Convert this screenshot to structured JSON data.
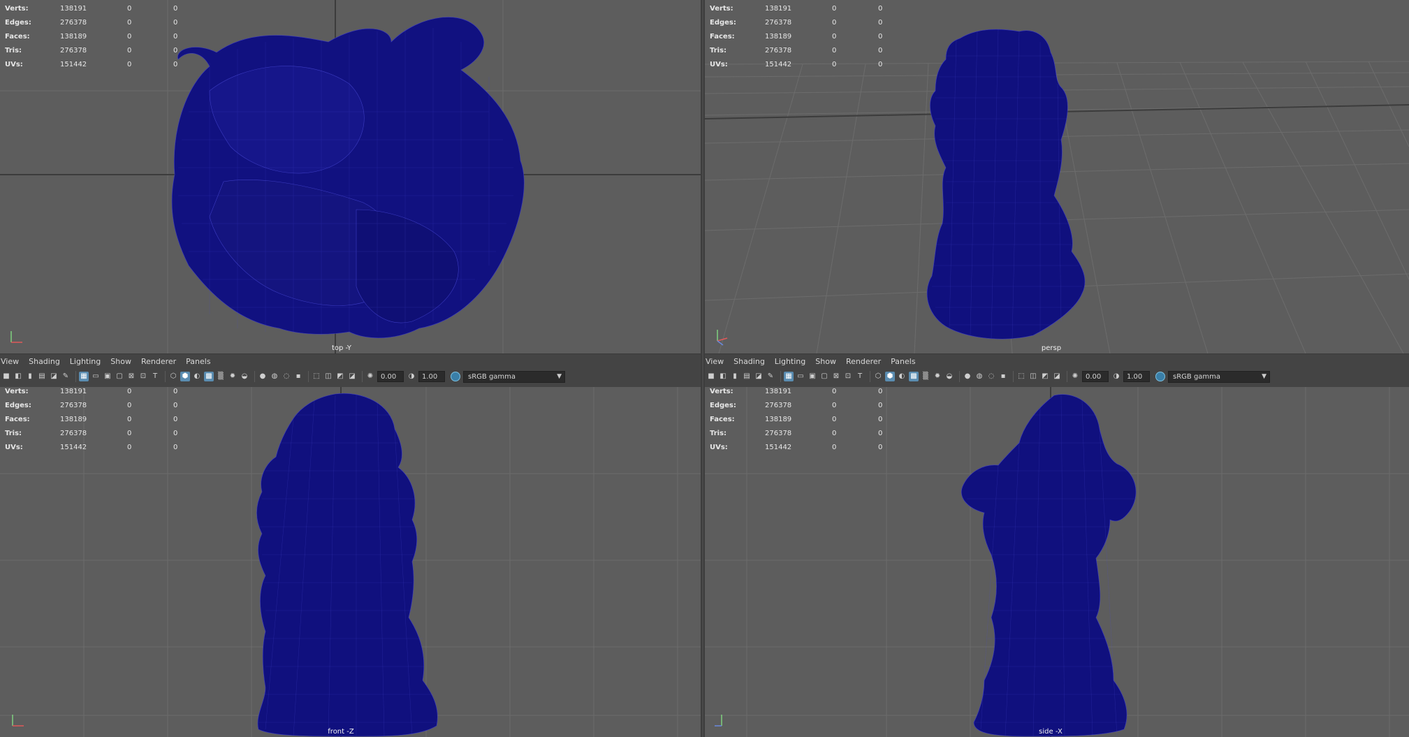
{
  "hud": {
    "labels": [
      "Verts:",
      "Edges:",
      "Faces:",
      "Tris:",
      "UVs:"
    ],
    "values": [
      "138191",
      "276378",
      "138189",
      "276378",
      "151442"
    ],
    "col2": [
      "0",
      "0",
      "0",
      "0",
      "0"
    ],
    "col3": [
      "0",
      "0",
      "0",
      "0",
      "0"
    ]
  },
  "viewports": {
    "top": "top -Y",
    "persp": "persp",
    "front": "front -Z",
    "side": "side -X"
  },
  "panel_menu": [
    "View",
    "Shading",
    "Lighting",
    "Show",
    "Renderer",
    "Panels"
  ],
  "toolbar": {
    "exposure": "0.00",
    "gamma": "1.00",
    "colorspace": "sRGB gamma"
  },
  "colors": {
    "viewport_bg": "#5d5d5d",
    "mesh": "#0f0f7a",
    "wire": "#3a3ab8",
    "grid": "#6a6a6a",
    "grid_axis": "#3a3a3a"
  },
  "icons": {
    "camera": "camera-icon",
    "select": "select-icon",
    "grid": "grid-icon",
    "wireframe": "wireframe-icon",
    "exposure": "exposure-icon"
  }
}
